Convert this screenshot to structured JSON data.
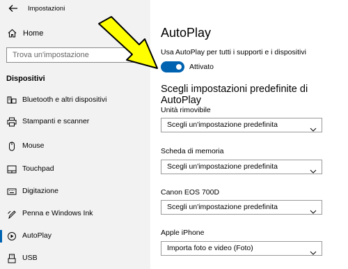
{
  "window": {
    "title": "Impostazioni"
  },
  "sidebar": {
    "home_label": "Home",
    "search_placeholder": "Trova un'impostazione",
    "section_title": "Dispositivi",
    "items": [
      {
        "label": "Bluetooth e altri dispositivi",
        "icon": "bluetooth-devices-icon"
      },
      {
        "label": "Stampanti e scanner",
        "icon": "printer-icon"
      },
      {
        "label": "Mouse",
        "icon": "mouse-icon"
      },
      {
        "label": "Touchpad",
        "icon": "touchpad-icon"
      },
      {
        "label": "Digitazione",
        "icon": "keyboard-icon"
      },
      {
        "label": "Penna e Windows Ink",
        "icon": "pen-icon"
      },
      {
        "label": "AutoPlay",
        "icon": "autoplay-icon",
        "active": true
      },
      {
        "label": "USB",
        "icon": "usb-icon"
      }
    ]
  },
  "main": {
    "title": "AutoPlay",
    "toggle": {
      "label": "Usa AutoPlay per tutti i supporti e i dispositivi",
      "state": "Attivato",
      "on": true
    },
    "section_title": "Scegli impostazioni predefinite di AutoPlay",
    "defaults": [
      {
        "label": "Unità rimovibile",
        "value": "Scegli un'impostazione predefinita"
      },
      {
        "label": "Scheda di memoria",
        "value": "Scegli un'impostazione predefinita"
      },
      {
        "label": "Canon EOS 700D",
        "value": "Scegli un'impostazione predefinita"
      },
      {
        "label": "Apple iPhone",
        "value": "Importa foto e video (Foto)"
      }
    ]
  },
  "colors": {
    "accent": "#0063b1",
    "sidebar_bg": "#f2f2f2",
    "annotation_arrow": "#ffff00"
  }
}
